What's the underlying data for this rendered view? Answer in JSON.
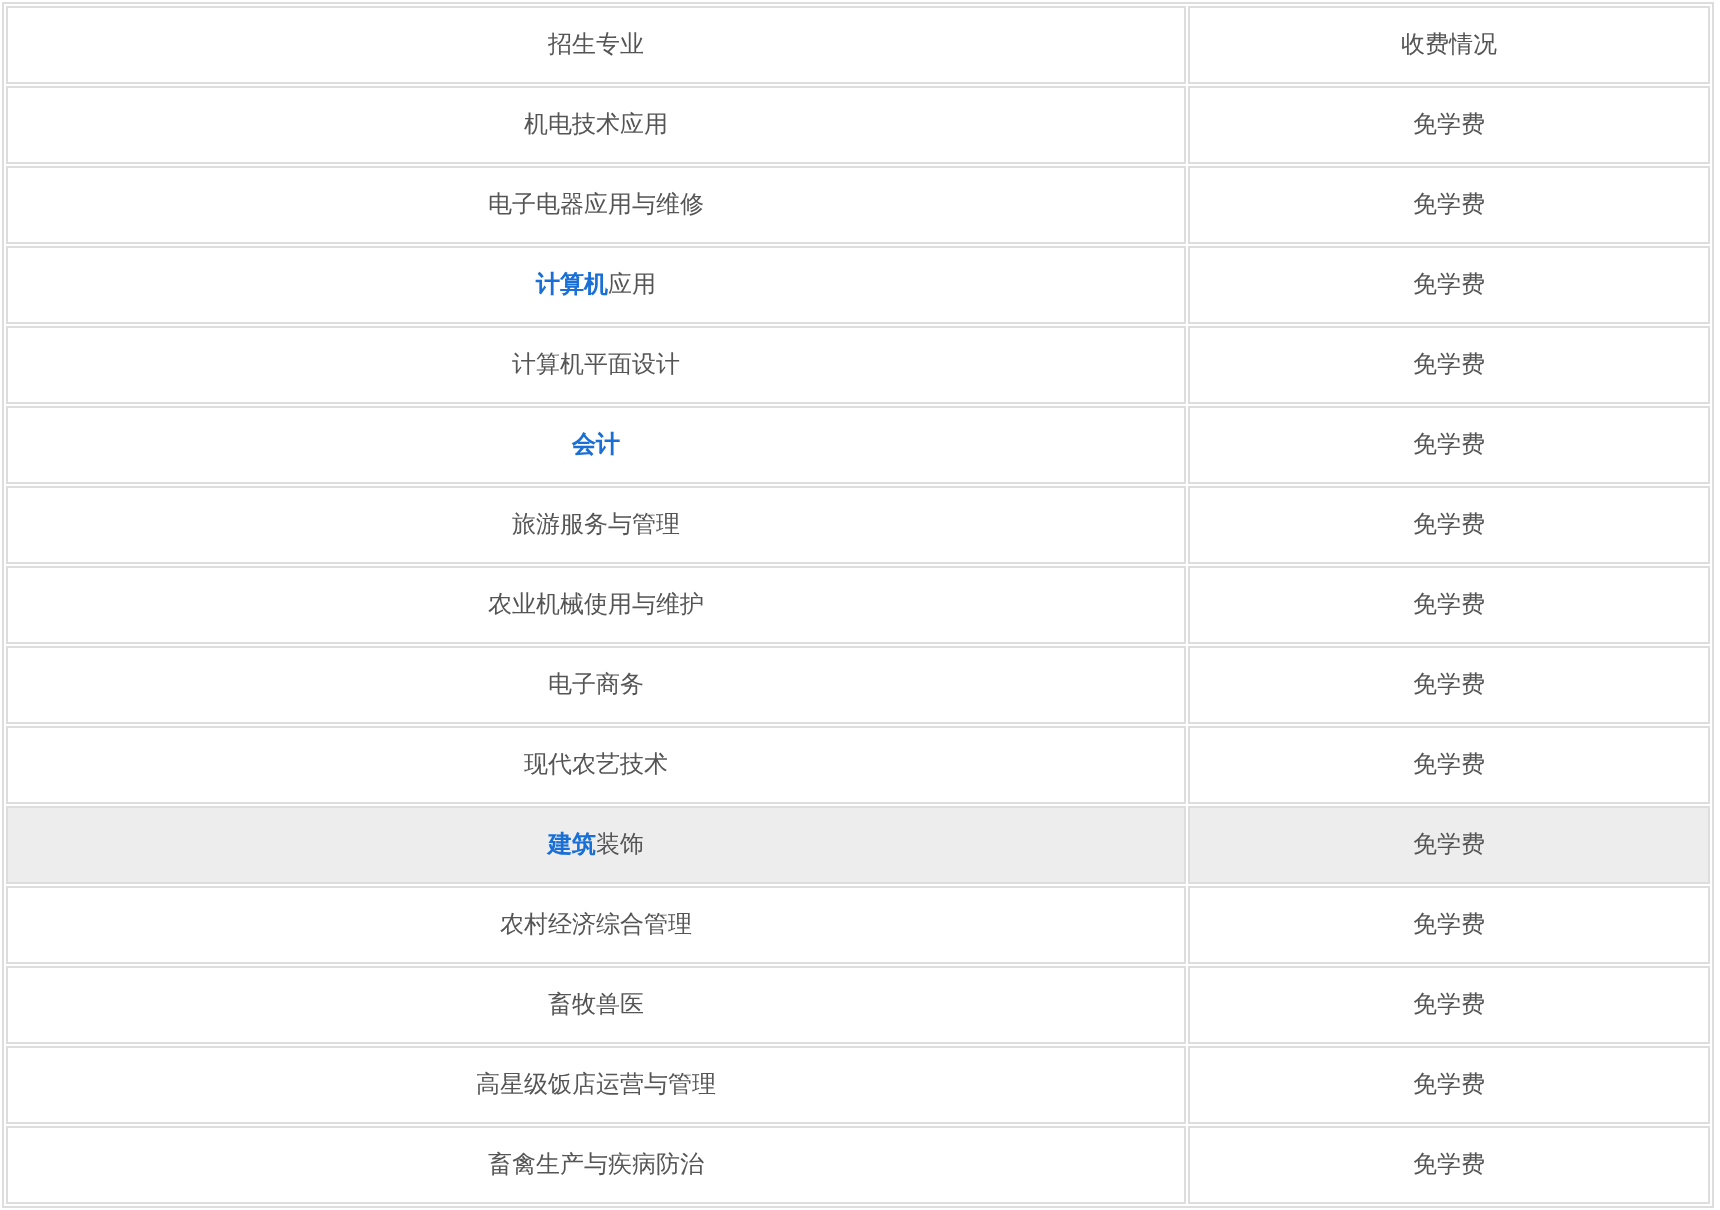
{
  "table": {
    "columns": [
      "招生专业",
      "收费情况"
    ],
    "rows": [
      {
        "program": [
          {
            "kind": "plain",
            "text": "机电技术应用"
          }
        ],
        "fee": "免学费",
        "highlighted": false
      },
      {
        "program": [
          {
            "kind": "plain",
            "text": "电子电器应用与维修"
          }
        ],
        "fee": "免学费",
        "highlighted": false
      },
      {
        "program": [
          {
            "kind": "link",
            "text": "计算机"
          },
          {
            "kind": "plain",
            "text": "应用"
          }
        ],
        "fee": "免学费",
        "highlighted": false
      },
      {
        "program": [
          {
            "kind": "plain",
            "text": "计算机平面设计"
          }
        ],
        "fee": "免学费",
        "highlighted": false
      },
      {
        "program": [
          {
            "kind": "link",
            "text": "会计"
          }
        ],
        "fee": "免学费",
        "highlighted": false
      },
      {
        "program": [
          {
            "kind": "plain",
            "text": "旅游服务与管理"
          }
        ],
        "fee": "免学费",
        "highlighted": false
      },
      {
        "program": [
          {
            "kind": "plain",
            "text": "农业机械使用与维护"
          }
        ],
        "fee": "免学费",
        "highlighted": false
      },
      {
        "program": [
          {
            "kind": "plain",
            "text": "电子商务"
          }
        ],
        "fee": "免学费",
        "highlighted": false
      },
      {
        "program": [
          {
            "kind": "plain",
            "text": "现代农艺技术"
          }
        ],
        "fee": "免学费",
        "highlighted": false
      },
      {
        "program": [
          {
            "kind": "link",
            "text": "建筑"
          },
          {
            "kind": "plain",
            "text": "装饰"
          }
        ],
        "fee": "免学费",
        "highlighted": true
      },
      {
        "program": [
          {
            "kind": "plain",
            "text": "农村经济综合管理"
          }
        ],
        "fee": "免学费",
        "highlighted": false
      },
      {
        "program": [
          {
            "kind": "plain",
            "text": "畜牧兽医"
          }
        ],
        "fee": "免学费",
        "highlighted": false
      },
      {
        "program": [
          {
            "kind": "plain",
            "text": "高星级饭店运营与管理"
          }
        ],
        "fee": "免学费",
        "highlighted": false
      },
      {
        "program": [
          {
            "kind": "plain",
            "text": "畜禽生产与疾病防治"
          }
        ],
        "fee": "免学费",
        "highlighted": false
      }
    ]
  }
}
